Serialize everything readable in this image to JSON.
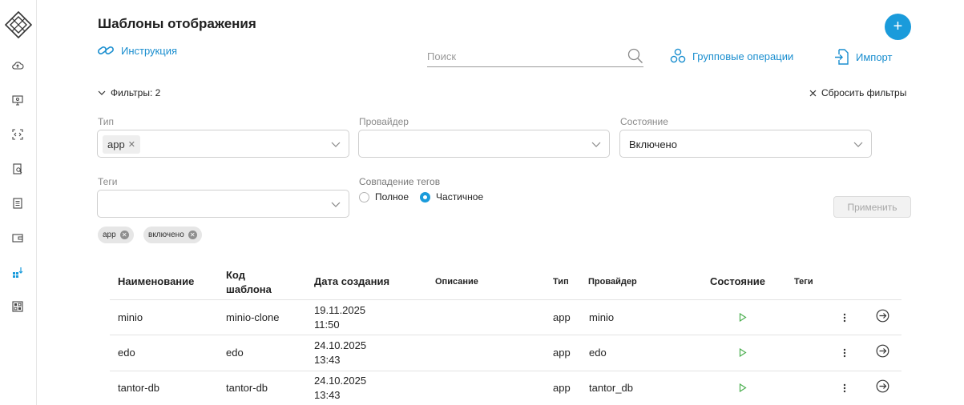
{
  "page": {
    "title": "Шаблоны отображения",
    "instruction_label": "Инструкция",
    "add_button": "+"
  },
  "sidebar": {
    "items": [
      {
        "icon": "cloud-upload-icon"
      },
      {
        "icon": "monitor-settings-icon"
      },
      {
        "icon": "code-scan-icon"
      },
      {
        "icon": "clipboard-search-icon"
      },
      {
        "icon": "document-list-icon"
      },
      {
        "icon": "wallet-icon"
      },
      {
        "icon": "templates-icon",
        "active": true
      },
      {
        "icon": "dashboard-icon"
      }
    ]
  },
  "toolbar": {
    "search_placeholder": "Поиск",
    "group_ops_label": "Групповые операции",
    "import_label": "Импорт"
  },
  "filters": {
    "toggle_label": "Фильтры: 2",
    "reset_label": "Сбросить фильтры",
    "type": {
      "label": "Тип",
      "chips": [
        "app"
      ]
    },
    "provider": {
      "label": "Провайдер",
      "value": ""
    },
    "state": {
      "label": "Состояние",
      "value": "Включено"
    },
    "tags": {
      "label": "Теги",
      "value": ""
    },
    "tag_match": {
      "label": "Совпадение тегов",
      "options": [
        "Полное",
        "Частичное"
      ],
      "selected": "Частичное"
    },
    "apply_label": "Применить",
    "active_pills": [
      "app",
      "включено"
    ]
  },
  "table": {
    "headers": {
      "name": "Наименование",
      "code": "Код шаблона",
      "created": "Дата создания",
      "description": "Описание",
      "type": "Тип",
      "provider": "Провайдер",
      "state": "Состояние",
      "tags": "Теги"
    },
    "rows": [
      {
        "name": "minio",
        "code": "minio-clone",
        "date": "19.11.2025",
        "time": "11:50",
        "description": "",
        "type": "app",
        "provider": "minio",
        "state": "enabled",
        "tags": ""
      },
      {
        "name": "edo",
        "code": "edo",
        "date": "24.10.2025",
        "time": "13:43",
        "description": "",
        "type": "app",
        "provider": "edo",
        "state": "enabled",
        "tags": ""
      },
      {
        "name": "tantor-db",
        "code": "tantor-db",
        "date": "24.10.2025",
        "time": "13:43",
        "description": "",
        "type": "app",
        "provider": "tantor_db",
        "state": "enabled",
        "tags": ""
      }
    ]
  },
  "colors": {
    "accent": "#1a9bdb",
    "link": "#1a8ecf",
    "play_green": "#4caf50"
  }
}
